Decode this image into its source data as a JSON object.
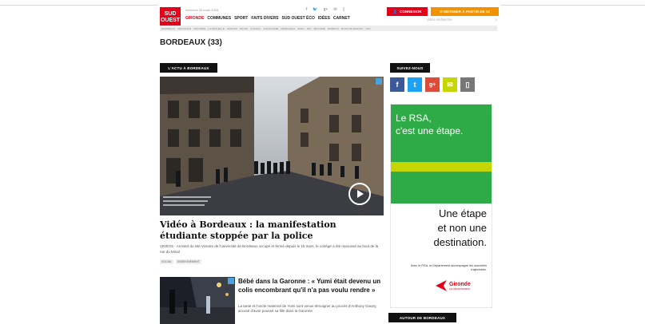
{
  "header": {
    "logo": [
      "SUD",
      "OUEST"
    ],
    "date": "mercredi 28 mars 2018",
    "social_icons": [
      "facebook-icon",
      "twitter-icon",
      "googleplus-icon",
      "mail-icon",
      "mobile-icon"
    ],
    "social_glyphs": [
      "f",
      "🐦",
      "g+",
      "✉",
      "▯"
    ],
    "connexion_label": "CONNEXION",
    "subscribe_label": "S'ABONNER À PARTIR DE 1€",
    "search_placeholder": "Votre recherche",
    "nav": [
      "GIRONDE",
      "COMMUNES",
      "SPORT",
      "FAITS DIVERS",
      "SUD OUEST ÉCO",
      "IDÉES",
      "CARNET"
    ],
    "subnav": [
      "BORDEAUX",
      "ARCACHON",
      "LIBOURNE",
      "LA ROCHELLE",
      "SAINTES",
      "ROYAN",
      "COGNAC",
      "ANGOULÊME",
      "PÉRIGUEUX",
      "AGEN",
      "PAU",
      "BAYONNE",
      "BIARRITZ",
      "MONT-DE-MARSAN",
      "DAX"
    ]
  },
  "page_title": "BORDEAUX (33)",
  "section_label": "L'ACTU À BORDEAUX",
  "main_article": {
    "headline": "Vidéo à Bordeaux : la manifestation étudiante stoppée par la police",
    "excerpt": "VIDÉOS - Arrivant du site Victoire de l'université de Bordeaux occupé et fermé depuis le 15 mars, le cortège a été repoussé au bout de la rue du Mirail",
    "tags": [
      "SOCIAL",
      "ENSEIGNEMENT"
    ]
  },
  "second_article": {
    "headline": "Bébé dans la Garonne : « Yumi était devenu un colis encombrant qu'il n'a pas voulu rendre »",
    "excerpt": "La tante et l'oncle maternel de Yumi sont venus témoigner au procès d'Anthony Gautry, accusé d'avoir poussé sa fille dans la Garonne"
  },
  "sidebar": {
    "follow_label": "SUIVEZ-NOUS",
    "social": [
      {
        "icon": "facebook-icon",
        "glyph": "f",
        "color": "#3b5998"
      },
      {
        "icon": "twitter-icon",
        "glyph": "t",
        "color": "#1da1f2"
      },
      {
        "icon": "googleplus-icon",
        "glyph": "g+",
        "color": "#dd4b39"
      },
      {
        "icon": "mail-icon",
        "glyph": "✉",
        "color": "#c6d600"
      },
      {
        "icon": "mobile-icon",
        "glyph": "▯",
        "color": "#777777"
      }
    ],
    "ad": {
      "line1": "Le RSA,",
      "line2": "c'est une étape.",
      "line3": "Une étape",
      "line4": "et non une",
      "line5": "destination.",
      "small": "Avec le RSA, le Département accompagne les nouvelles trajectoires.",
      "brand": "Gironde",
      "brand_sub": "LE DÉPARTEMENT"
    },
    "around_label": "AUTOUR DE BORDEAUX"
  },
  "colors": {
    "brand_red": "#e2001a",
    "orange": "#f39200",
    "ad_green": "#2eaa46",
    "ad_yellow": "#c6d600"
  }
}
